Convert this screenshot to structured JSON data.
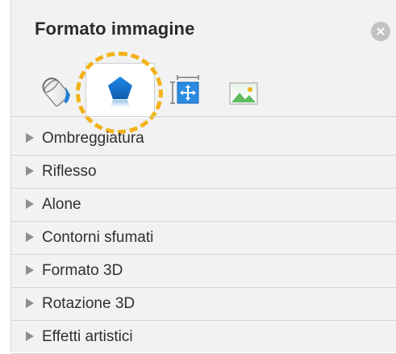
{
  "panel": {
    "title": "Formato immagine",
    "close_icon": "close-circle-icon"
  },
  "tabs": [
    {
      "name": "fill-and-line",
      "icon": "paint-bucket-icon",
      "selected": false
    },
    {
      "name": "effects",
      "icon": "pentagon-icon",
      "selected": true
    },
    {
      "name": "size-and-properties",
      "icon": "size-properties-icon",
      "selected": false
    },
    {
      "name": "picture",
      "icon": "picture-icon",
      "selected": false
    }
  ],
  "sections": [
    {
      "label": "Ombreggiatura",
      "expanded": false
    },
    {
      "label": "Riflesso",
      "expanded": false
    },
    {
      "label": "Alone",
      "expanded": false
    },
    {
      "label": "Contorni sfumati",
      "expanded": false
    },
    {
      "label": "Formato 3D",
      "expanded": false
    },
    {
      "label": "Rotazione 3D",
      "expanded": false
    },
    {
      "label": "Effetti artistici",
      "expanded": false
    }
  ],
  "colors": {
    "accent_blue": "#1f7fd6",
    "highlight_yellow": "#f2b218",
    "panel_bg": "#f2f2f2"
  }
}
